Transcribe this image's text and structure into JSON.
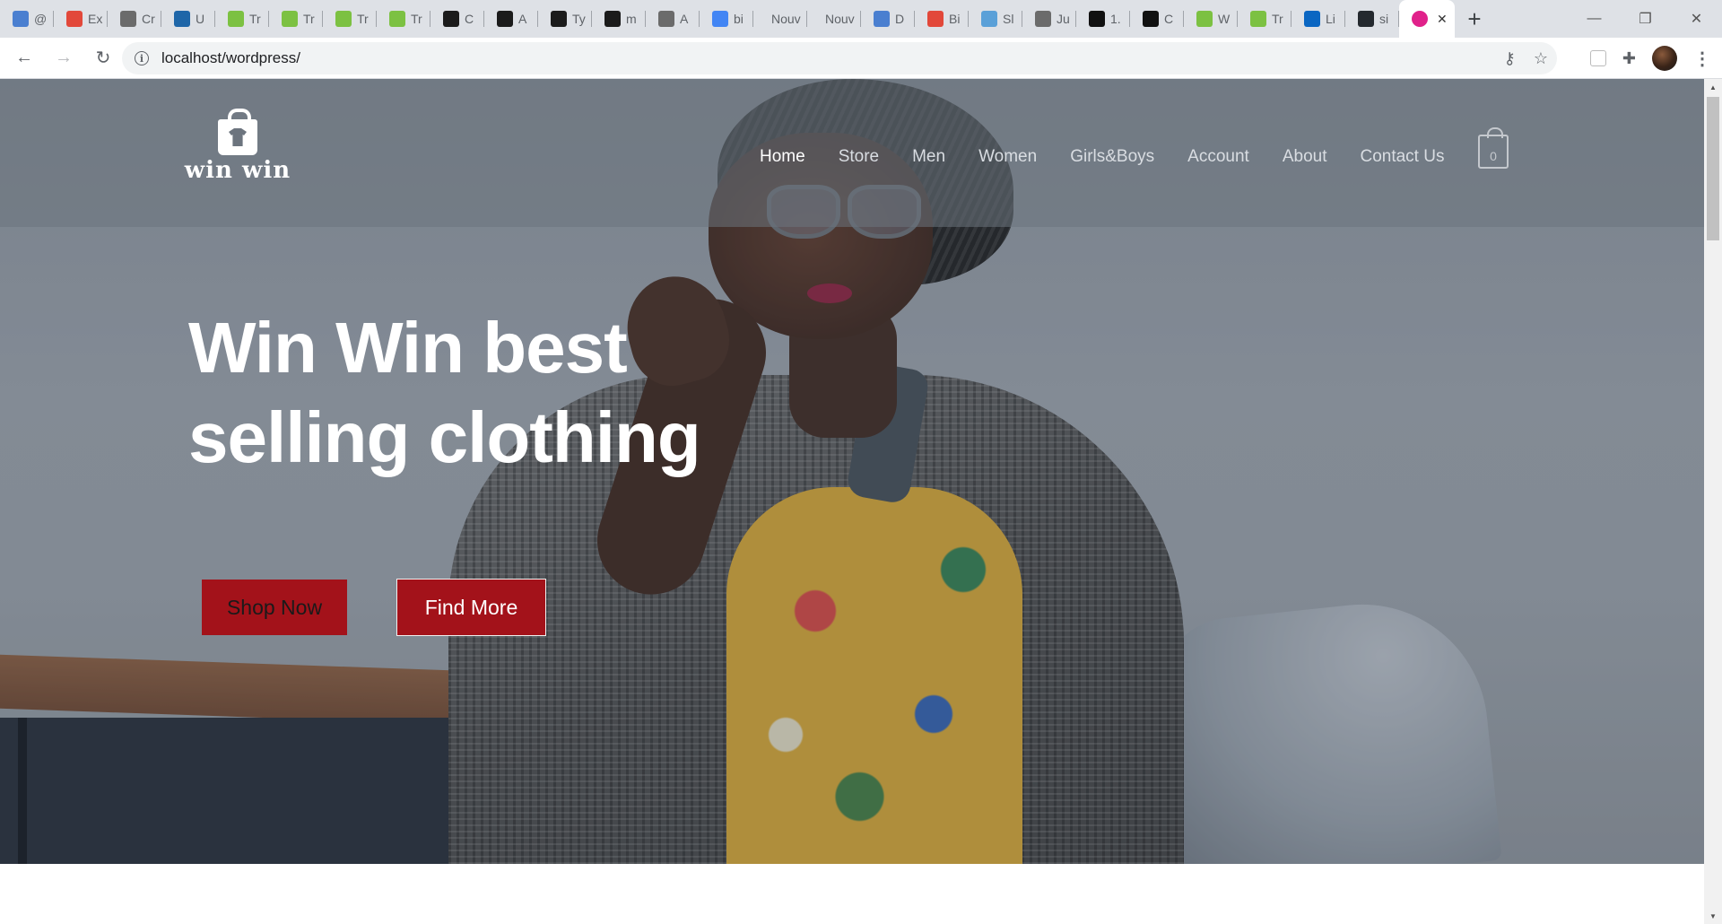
{
  "browser": {
    "tabs": [
      {
        "title": "@",
        "icon": "youtube-favicon",
        "color": "#4a7fd0"
      },
      {
        "title": "Ex",
        "icon": "code-favicon",
        "color": "#e2483a"
      },
      {
        "title": "Cr",
        "icon": "globe-favicon",
        "color": "#6b6b6b"
      },
      {
        "title": "U",
        "icon": "udemy-favicon",
        "color": "#1e66a8"
      },
      {
        "title": "Tr",
        "icon": "w3-favicon",
        "color": "#7cc142"
      },
      {
        "title": "Tr",
        "icon": "w3-favicon",
        "color": "#7cc142"
      },
      {
        "title": "Tr",
        "icon": "w3-favicon",
        "color": "#7cc142"
      },
      {
        "title": "Tr",
        "icon": "w3-favicon",
        "color": "#7cc142"
      },
      {
        "title": "C",
        "icon": "codepen-favicon",
        "color": "#1b1b1b"
      },
      {
        "title": "A",
        "icon": "codepen-favicon",
        "color": "#1b1b1b"
      },
      {
        "title": "Ty",
        "icon": "codepen-favicon",
        "color": "#1b1b1b"
      },
      {
        "title": "m",
        "icon": "codepen-favicon",
        "color": "#1b1b1b"
      },
      {
        "title": "A",
        "icon": "globe-favicon",
        "color": "#6b6b6b"
      },
      {
        "title": "bi",
        "icon": "google-favicon",
        "color": "#4285f4"
      },
      {
        "title": "Nouv",
        "icon": "none",
        "color": "#dee1e6"
      },
      {
        "title": "Nouv",
        "icon": "none",
        "color": "#dee1e6"
      },
      {
        "title": "D",
        "icon": "youtube-favicon",
        "color": "#4a7fd0"
      },
      {
        "title": "Bi",
        "icon": "code-favicon",
        "color": "#e2483a"
      },
      {
        "title": "Sl",
        "icon": "image-favicon",
        "color": "#5aa0d8"
      },
      {
        "title": "Ju",
        "icon": "globe-favicon",
        "color": "#6b6b6b"
      },
      {
        "title": "1.",
        "icon": "figma-favicon",
        "color": "#111111"
      },
      {
        "title": "C",
        "icon": "figma-favicon",
        "color": "#111111"
      },
      {
        "title": "W",
        "icon": "w3-favicon",
        "color": "#7cc142"
      },
      {
        "title": "Tr",
        "icon": "w3-favicon",
        "color": "#7cc142"
      },
      {
        "title": "Li",
        "icon": "linkedin-favicon",
        "color": "#0a66c2"
      },
      {
        "title": "si",
        "icon": "github-favicon",
        "color": "#24292e"
      }
    ],
    "active_tab": {
      "title": "",
      "icon": "wordpress-favicon",
      "color": "#e0218a"
    },
    "new_tab": "+",
    "window_controls": {
      "minimize": "—",
      "maximize": "❐",
      "close": "✕"
    },
    "url": "localhost/wordpress/",
    "info_icon": "i"
  },
  "site": {
    "logo_text": "win win",
    "nav": [
      "Home",
      "Store",
      "Men",
      "Women",
      "Girls&Boys",
      "Account",
      "About",
      "Contact Us"
    ],
    "active_nav": "Home",
    "cart_count": "0",
    "hero_title": "Win Win best selling clothing",
    "buttons": {
      "shop": "Shop Now",
      "find": "Find More"
    },
    "colors": {
      "accent": "#a3121a",
      "header_overlay": "#6c747e"
    }
  }
}
